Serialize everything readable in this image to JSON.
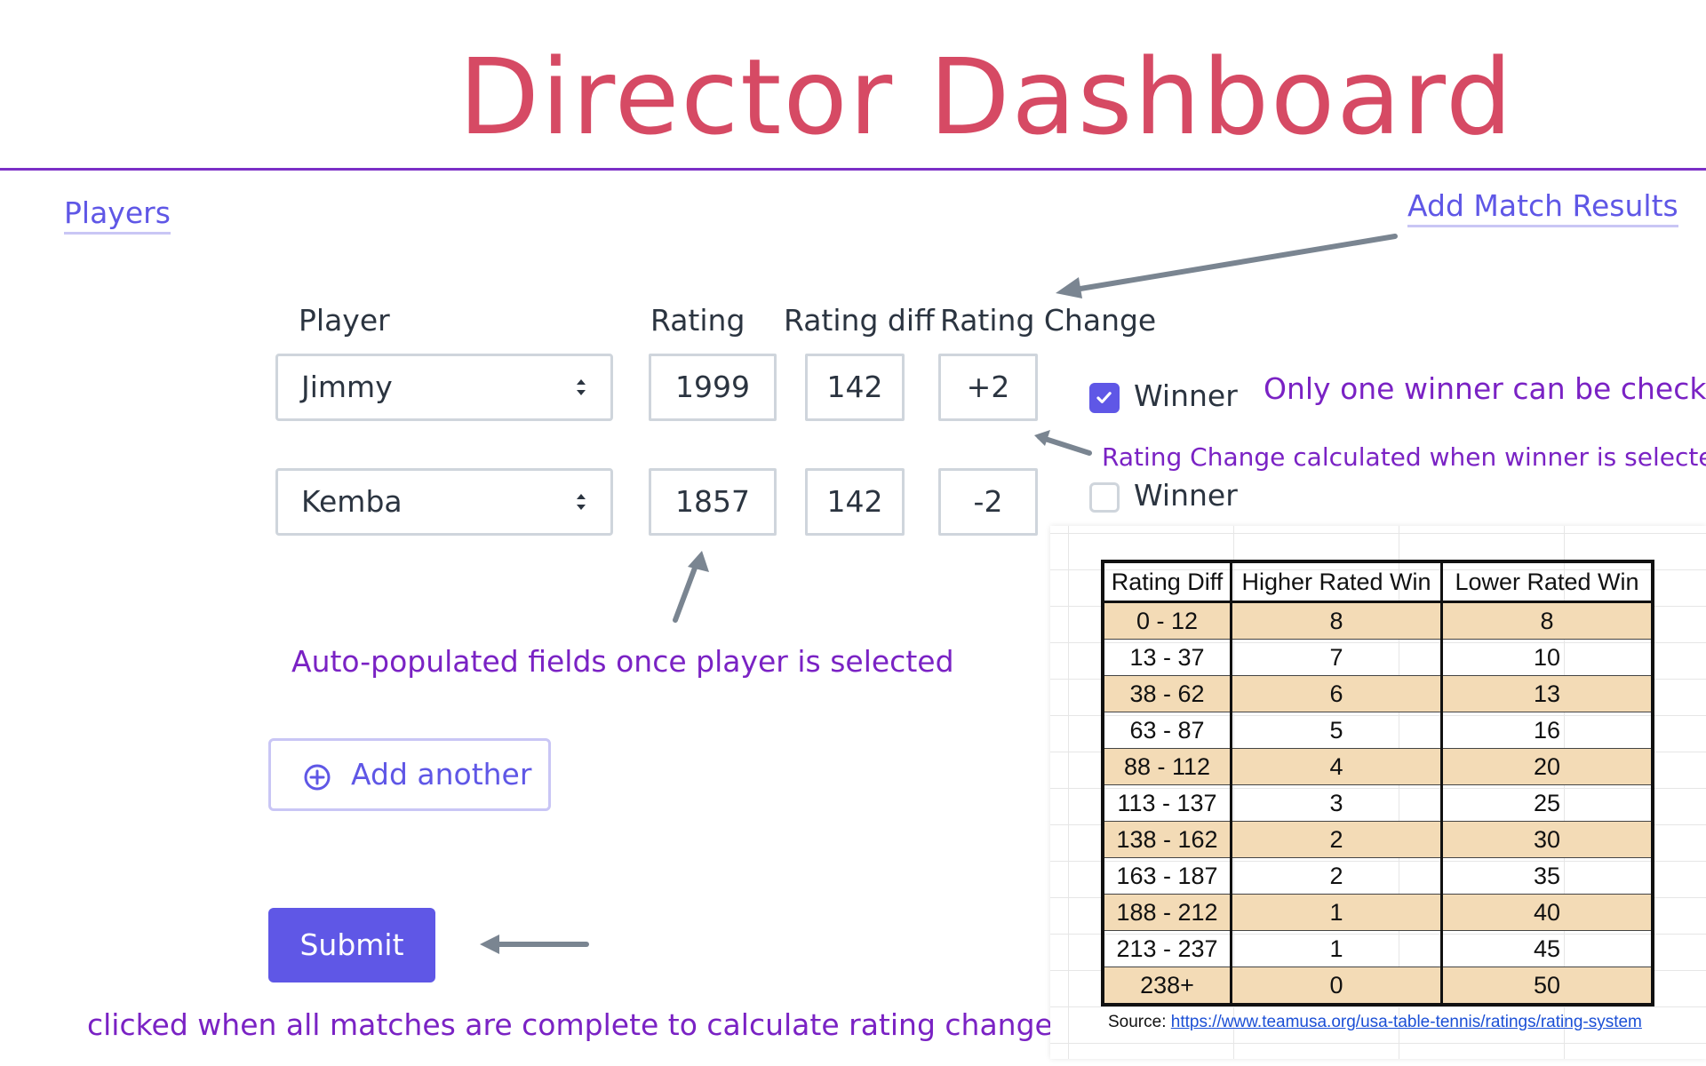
{
  "header": {
    "title": "Director Dashboard"
  },
  "nav": {
    "players_link": "Players",
    "add_match_link": "Add Match Results"
  },
  "columns": {
    "player": "Player",
    "rating": "Rating",
    "rating_diff": "Rating diff",
    "rating_change": "Rating Change"
  },
  "rows": [
    {
      "player": "Jimmy",
      "rating": "1999",
      "rating_diff": "142",
      "rating_change": "+2",
      "winner_label": "Winner",
      "winner_checked": true
    },
    {
      "player": "Kemba",
      "rating": "1857",
      "rating_diff": "142",
      "rating_change": "-2",
      "winner_label": "Winner",
      "winner_checked": false
    }
  ],
  "annotations": {
    "one_winner": "Only one winner can be checked",
    "rating_change_calc": "Rating Change calculated when winner is selected",
    "auto_populated": "Auto-populated fields once player is selected",
    "submit_note": "clicked when all matches are complete to calculate rating changes"
  },
  "buttons": {
    "add_another": "Add another",
    "submit": "Submit"
  },
  "rating_table": {
    "headers": [
      "Rating Diff",
      "Higher Rated Win",
      "Lower Rated Win"
    ],
    "rows": [
      [
        "0 - 12",
        "8",
        "8"
      ],
      [
        "13 - 37",
        "7",
        "10"
      ],
      [
        "38 - 62",
        "6",
        "13"
      ],
      [
        "63 - 87",
        "5",
        "16"
      ],
      [
        "88 - 112",
        "4",
        "20"
      ],
      [
        "113 - 137",
        "3",
        "25"
      ],
      [
        "138 - 162",
        "2",
        "30"
      ],
      [
        "163 - 187",
        "2",
        "35"
      ],
      [
        "188 - 212",
        "1",
        "40"
      ],
      [
        "213 - 237",
        "1",
        "45"
      ],
      [
        "238+",
        "0",
        "50"
      ]
    ],
    "source_label": "Source:",
    "source_url": "https://www.teamusa.org/usa-table-tennis/ratings/rating-system"
  },
  "colors": {
    "title": "#d64a64",
    "accent": "#5f57e6",
    "annotation": "#7a22c4",
    "rule": "#7b2fc6",
    "table_shade": "#f3dbb6"
  }
}
